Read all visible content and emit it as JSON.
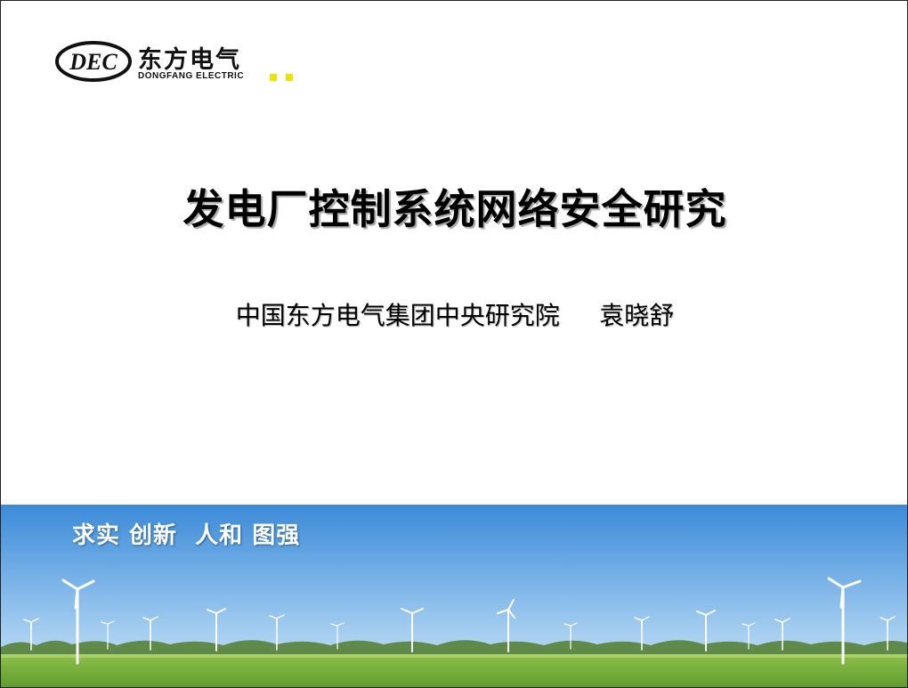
{
  "logo": {
    "mark_text": "DEC",
    "company_cn": "东方电气",
    "company_en": "DONGFANG ELECTRIC"
  },
  "slide": {
    "title": "发电厂控制系统网络安全研究",
    "subtitle": "中国东方电气集团中央研究院     袁晓舒"
  },
  "banner": {
    "slogan": "求实 创新  人和 图强"
  },
  "colors": {
    "accent_yellow": "#f2e200",
    "logo_blue": "#1e3f8f",
    "sky_top": "#3e8fdc",
    "grass": "#7fb83e"
  }
}
